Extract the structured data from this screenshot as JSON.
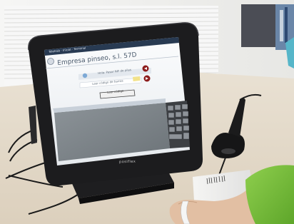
{
  "screen": {
    "app_title": "Empresa pinseo, s.l. 57D",
    "titlebar_text": "Teletrab · Inicial · Terminal",
    "message_a": "Hola. Pasar NIF de pilas",
    "message_b": "Leer código de barras",
    "button_label": "Leer código"
  },
  "device": {
    "brand_label": "posiflex"
  },
  "colors": {
    "wall": "#f3f3f1",
    "desk": "#ece2d2",
    "bezel": "#1b1b1d",
    "screen": "#f2f4f6",
    "shirt": "#7dc13f"
  }
}
